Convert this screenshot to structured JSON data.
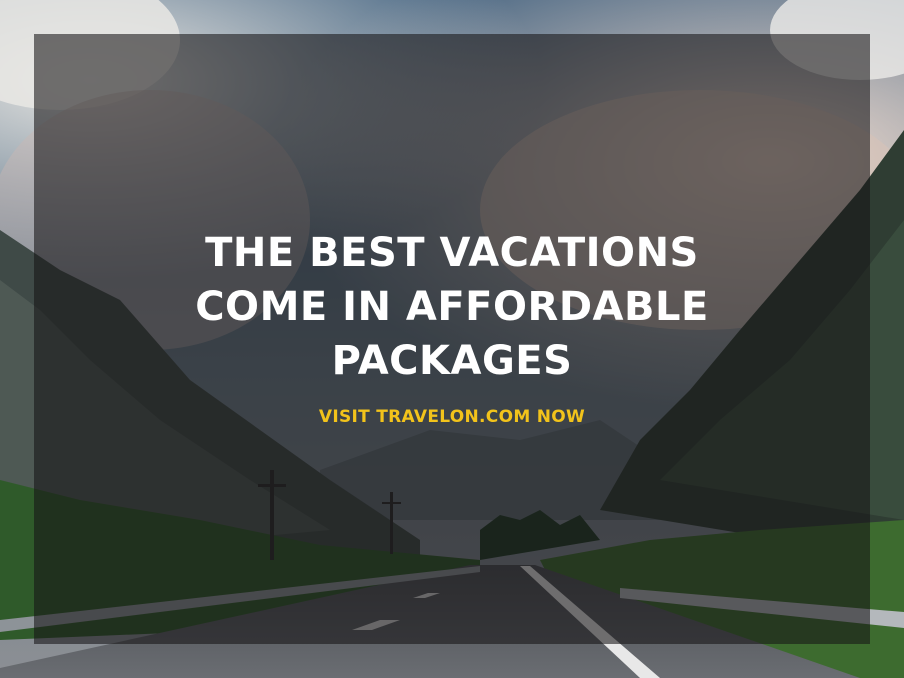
{
  "headline": {
    "lines": [
      "THE BEST VACATIONS",
      "COME IN AFFORDABLE",
      "PACKAGES"
    ]
  },
  "cta": {
    "label": "VISIT TRAVELON.COM NOW"
  },
  "colors": {
    "headline": "#ffffff",
    "cta": "#f2c31b",
    "overlay": "#161416"
  }
}
